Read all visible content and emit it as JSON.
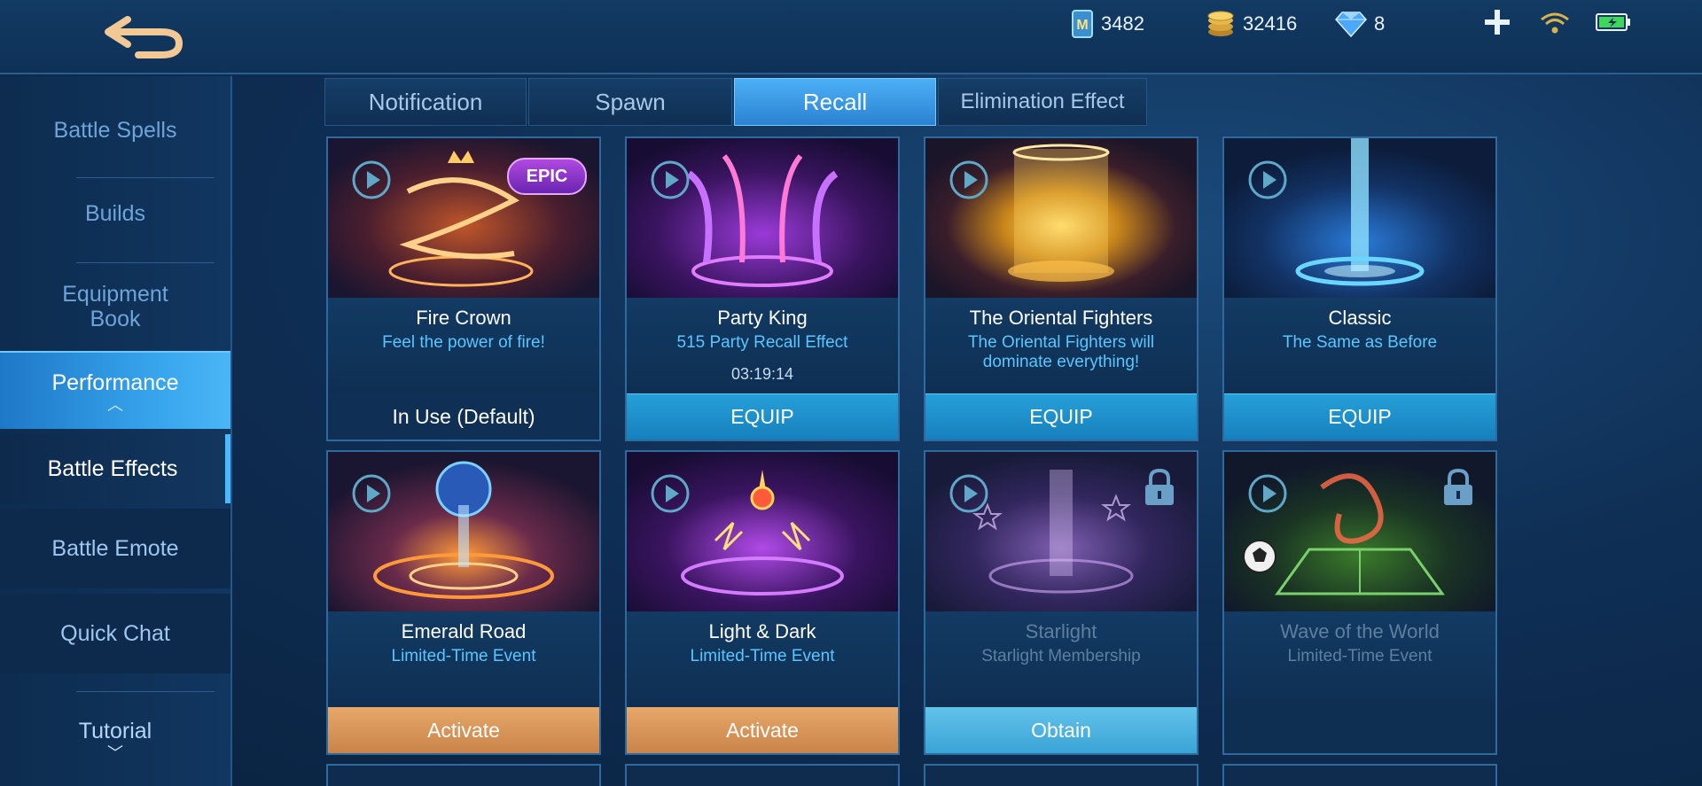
{
  "currencies": [
    {
      "name": "m-ticket-icon",
      "value": "3482"
    },
    {
      "name": "gold-coin-icon",
      "value": "32416"
    },
    {
      "name": "diamond-icon",
      "value": "8"
    }
  ],
  "sidebar": {
    "items": [
      {
        "label": "Battle Spells"
      },
      {
        "label": "Builds"
      },
      {
        "label": "Equipment Book"
      },
      {
        "label": "Performance"
      },
      {
        "label": "Battle Effects"
      },
      {
        "label": "Battle Emote"
      },
      {
        "label": "Quick Chat"
      },
      {
        "label": "Tutorial"
      }
    ]
  },
  "tabs": [
    {
      "label": "Notification"
    },
    {
      "label": "Spawn"
    },
    {
      "label": "Recall",
      "active": true
    },
    {
      "label": "Elimination Effect"
    }
  ],
  "cards": [
    {
      "title": "Fire Crown",
      "subtitle": "Feel the power of fire!",
      "button": "In Use (Default)",
      "badge": "EPIC"
    },
    {
      "title": "Party King",
      "subtitle": "515 Party Recall Effect",
      "timer": "03:19:14",
      "button": "EQUIP"
    },
    {
      "title": "The Oriental Fighters",
      "subtitle": "The Oriental Fighters will dominate everything!",
      "button": "EQUIP"
    },
    {
      "title": "Classic",
      "subtitle": "The Same as Before",
      "button": "EQUIP"
    },
    {
      "title": "Emerald Road",
      "subtitle": "Limited-Time Event",
      "button": "Activate"
    },
    {
      "title": "Light & Dark",
      "subtitle": "Limited-Time Event",
      "button": "Activate"
    },
    {
      "title": "Starlight",
      "subtitle": "Starlight Membership",
      "button": "Obtain",
      "locked": true
    },
    {
      "title": "Wave of the World",
      "subtitle": "Limited-Time Event",
      "button": "",
      "locked": true
    }
  ],
  "colors": {
    "accent": "#4bb9ff",
    "equip": "#1e90c8",
    "activate": "#d8965a",
    "subtitle": "#59c6ff"
  }
}
